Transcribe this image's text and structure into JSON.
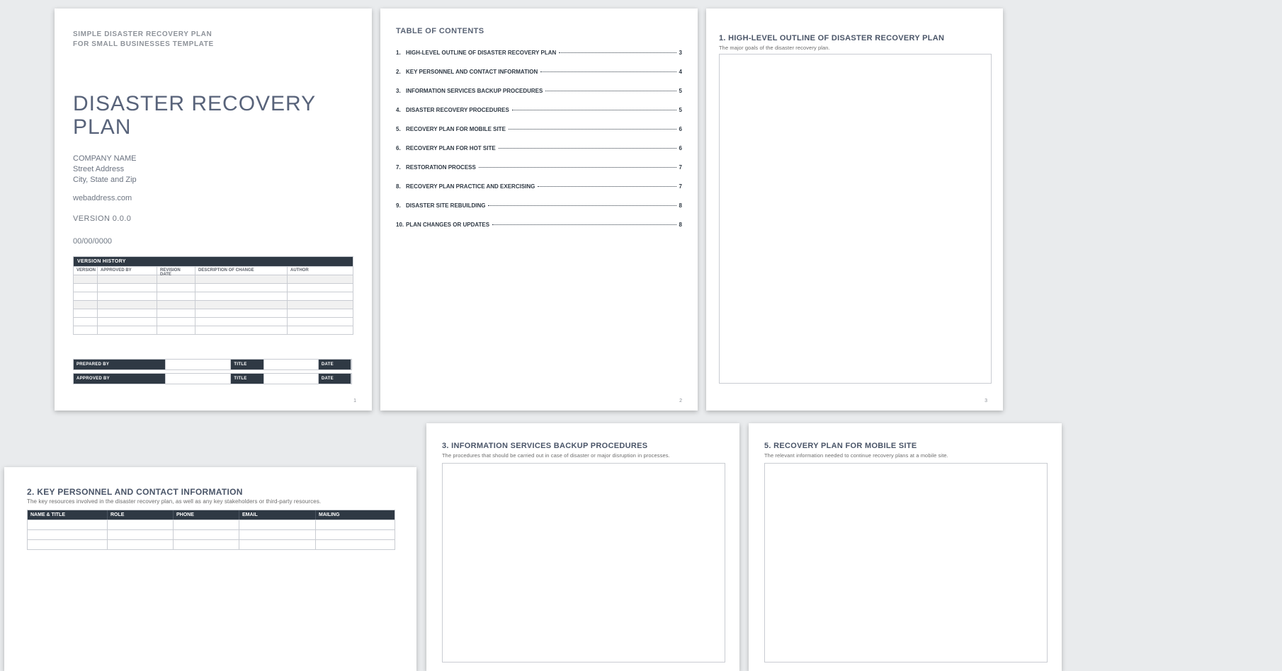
{
  "page1": {
    "supertitle_l1": "SIMPLE DISASTER RECOVERY PLAN",
    "supertitle_l2": "FOR SMALL BUSINESSES TEMPLATE",
    "title_l1": "DISASTER RECOVERY",
    "title_l2": "PLAN",
    "company_name": "COMPANY NAME",
    "street": "Street Address",
    "csz": "City, State and Zip",
    "web": "webaddress.com",
    "version": "VERSION 0.0.0",
    "date": "00/00/0000",
    "version_history": "VERSION HISTORY",
    "vh_cols": {
      "c0": "VERSION",
      "c1": "APPROVED BY",
      "c2": "REVISION DATE",
      "c3": "DESCRIPTION OF CHANGE",
      "c4": "AUTHOR"
    },
    "kv": {
      "prepared": "PREPARED BY",
      "approved": "APPROVED BY",
      "title": "TITLE",
      "date": "DATE"
    },
    "pgno": "1"
  },
  "page2": {
    "heading": "TABLE OF CONTENTS",
    "items": [
      {
        "n": "1.",
        "t": "HIGH-LEVEL OUTLINE OF DISASTER RECOVERY PLAN",
        "p": "3"
      },
      {
        "n": "2.",
        "t": "KEY PERSONNEL AND CONTACT INFORMATION",
        "p": "4"
      },
      {
        "n": "3.",
        "t": "INFORMATION SERVICES BACKUP PROCEDURES",
        "p": "5"
      },
      {
        "n": "4.",
        "t": "DISASTER RECOVERY PROCEDURES",
        "p": "5"
      },
      {
        "n": "5.",
        "t": "RECOVERY PLAN FOR MOBILE SITE",
        "p": "6"
      },
      {
        "n": "6.",
        "t": "RECOVERY PLAN FOR HOT SITE",
        "p": "6"
      },
      {
        "n": "7.",
        "t": "RESTORATION PROCESS",
        "p": "7"
      },
      {
        "n": "8.",
        "t": "RECOVERY PLAN PRACTICE AND EXERCISING",
        "p": "7"
      },
      {
        "n": "9.",
        "t": "DISASTER SITE REBUILDING",
        "p": "8"
      },
      {
        "n": "10.",
        "t": "PLAN CHANGES OR UPDATES",
        "p": "8"
      }
    ],
    "pgno": "2"
  },
  "page3": {
    "heading": "1.  HIGH-LEVEL OUTLINE OF DISASTER RECOVERY PLAN",
    "sub": "The major goals of the disaster recovery plan.",
    "pgno": "3"
  },
  "page4": {
    "heading": "2.  KEY PERSONNEL AND CONTACT INFORMATION",
    "sub": "The key resources involved in the disaster recovery plan, as well as any key stakeholders or third-party resources.",
    "cols": {
      "c0": "NAME & TITLE",
      "c1": "ROLE",
      "c2": "PHONE",
      "c3": "EMAIL",
      "c4": "MAILING"
    }
  },
  "page5": {
    "heading": "3.  INFORMATION SERVICES BACKUP PROCEDURES",
    "sub": "The procedures that should be carried out in case of disaster or major disruption in processes."
  },
  "page6": {
    "heading": "5.  RECOVERY PLAN FOR MOBILE SITE",
    "sub": "The relevant information needed to continue recovery plans at a mobile site."
  }
}
